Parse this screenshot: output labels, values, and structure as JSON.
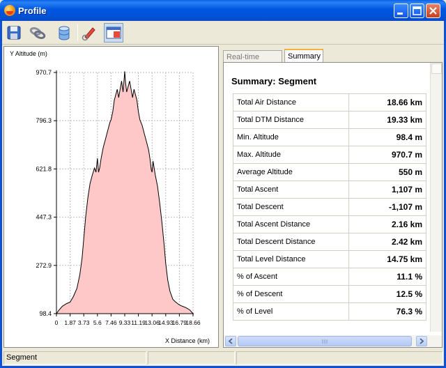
{
  "window": {
    "title": "Profile"
  },
  "toolbar": {
    "tools": [
      {
        "icon": "save-icon"
      },
      {
        "icon": "link-icon"
      },
      {
        "icon": "database-icon"
      },
      {
        "icon": "measure-pencil-icon"
      },
      {
        "icon": "window-layout-icon",
        "active": true
      }
    ]
  },
  "chart_data": {
    "type": "area",
    "ylabel": "Y Altitude (m)",
    "xlabel": "X Distance (km)",
    "xlim": [
      0,
      18.66
    ],
    "ylim": [
      98.4,
      970.7
    ],
    "xticks": [
      "0",
      "1.87",
      "3.73",
      "5.6",
      "7.46",
      "9.33",
      "11.19",
      "13.06",
      "14.93",
      "16.79",
      "18.66"
    ],
    "yticks": [
      "98.4",
      "272.9",
      "447.3",
      "621.8",
      "796.3",
      "970.7"
    ],
    "grid": true,
    "fill_color": "#ffc8c8",
    "line_color": "#000000",
    "x": [
      0,
      0.3,
      0.8,
      1.4,
      1.87,
      2.3,
      2.8,
      3.2,
      3.5,
      3.73,
      4.0,
      4.3,
      4.6,
      4.9,
      5.2,
      5.4,
      5.6,
      5.75,
      5.9,
      6.1,
      6.4,
      6.7,
      7.0,
      7.3,
      7.46,
      7.7,
      7.9,
      8.1,
      8.3,
      8.5,
      8.7,
      8.9,
      9.1,
      9.2,
      9.33,
      9.45,
      9.6,
      9.8,
      10.0,
      10.2,
      10.4,
      10.6,
      10.8,
      11.0,
      11.19,
      11.4,
      11.7,
      12.0,
      12.3,
      12.6,
      12.8,
      12.95,
      13.06,
      13.2,
      13.5,
      13.8,
      14.1,
      14.4,
      14.7,
      14.93,
      15.2,
      15.5,
      15.9,
      16.3,
      16.79,
      17.2,
      17.7,
      18.2,
      18.66
    ],
    "y": [
      98.4,
      110,
      125,
      135,
      140,
      160,
      190,
      240,
      300,
      370,
      450,
      520,
      570,
      600,
      625,
      610,
      660,
      610,
      625,
      660,
      700,
      730,
      760,
      790,
      800,
      830,
      870,
      890,
      910,
      880,
      910,
      940,
      900,
      930,
      975,
      930,
      900,
      920,
      940,
      910,
      880,
      910,
      890,
      870,
      830,
      800,
      780,
      750,
      720,
      690,
      655,
      620,
      610,
      650,
      600,
      560,
      500,
      430,
      350,
      280,
      220,
      180,
      150,
      140,
      130,
      125,
      120,
      112,
      98.4
    ]
  },
  "tabs": [
    {
      "label": "Real-time Profile",
      "active": false
    },
    {
      "label": "Summary",
      "active": true
    }
  ],
  "summary": {
    "title": "Summary: Segment",
    "rows": [
      {
        "label": "Total Air Distance",
        "value": "18.66 km"
      },
      {
        "label": "Total DTM Distance",
        "value": "19.33 km"
      },
      {
        "label": "Min. Altitude",
        "value": "98.4 m"
      },
      {
        "label": "Max. Altitude",
        "value": "970.7 m"
      },
      {
        "label": "Average Altitude",
        "value": "550 m"
      },
      {
        "label": "Total Ascent",
        "value": "1,107 m"
      },
      {
        "label": "Total Descent",
        "value": "-1,107 m"
      },
      {
        "label": "Total Ascent Distance",
        "value": "2.16 km"
      },
      {
        "label": "Total Descent Distance",
        "value": "2.42 km"
      },
      {
        "label": "Total Level Distance",
        "value": "14.75 km"
      },
      {
        "label": "% of Ascent",
        "value": "11.1 %"
      },
      {
        "label": "% of Descent",
        "value": "12.5 %"
      },
      {
        "label": "% of Level",
        "value": "76.3 %"
      }
    ]
  },
  "status": {
    "text": "Segment"
  }
}
